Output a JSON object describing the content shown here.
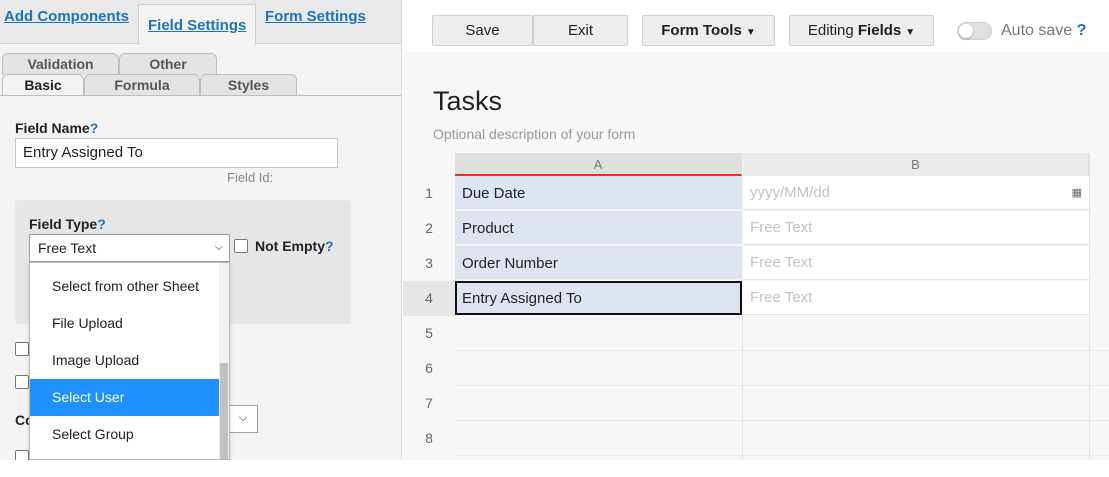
{
  "left_tabs": {
    "add_components": "Add Components",
    "field_settings": "Field Settings",
    "form_settings": "Form Settings"
  },
  "sub_tabs": {
    "validation": "Validation",
    "other": "Other",
    "basic": "Basic",
    "formula": "Formula",
    "styles": "Styles"
  },
  "field_name": {
    "label": "Field Name",
    "help": "?",
    "value": "Entry Assigned To",
    "field_id_label": "Field Id:"
  },
  "field_type": {
    "label": "Field Type",
    "help": "?",
    "value": "Free Text",
    "not_empty_label": "Not Empty",
    "not_empty_help": "?"
  },
  "dropdown": {
    "items": [
      "Select from other Sheet",
      "File Upload",
      "Image Upload",
      "Select User",
      "Select Group"
    ],
    "selected": "Select User"
  },
  "partial_label": "Co",
  "toolbar": {
    "save": "Save",
    "exit": "Exit",
    "form_tools": "Form Tools",
    "editing_prefix": "Editing",
    "editing_mode": "Fields",
    "autosave": "Auto save",
    "autosave_help": "?"
  },
  "form": {
    "title": "Tasks",
    "description": "Optional description of your form"
  },
  "grid": {
    "columns": [
      "A",
      "B"
    ],
    "rows": [
      {
        "num": "1",
        "a": "Due Date",
        "b": "yyyy/MM/dd"
      },
      {
        "num": "2",
        "a": "Product",
        "b": "Free Text"
      },
      {
        "num": "3",
        "a": "Order Number",
        "b": "Free Text"
      },
      {
        "num": "4",
        "a": "Entry Assigned To",
        "b": "Free Text"
      }
    ],
    "empty_rows": [
      "5",
      "6",
      "7",
      "8"
    ]
  },
  "colors": {
    "link": "#1a73c4",
    "selected": "#1e90ff",
    "active_cell_bg": "#dde4ef",
    "active_col_line": "#dd3333"
  }
}
